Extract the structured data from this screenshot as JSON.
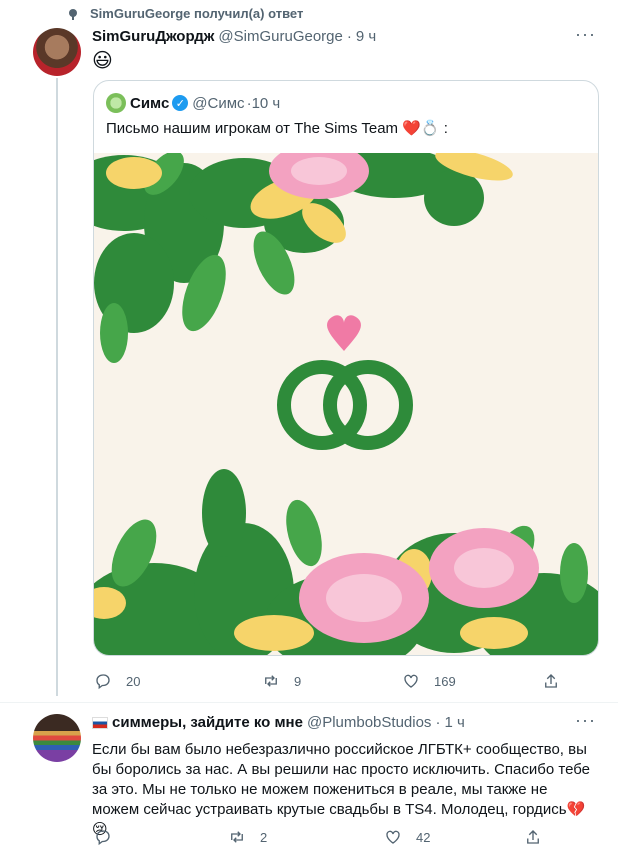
{
  "context": {
    "text": "SimGuruGeorge получил(а) ответ"
  },
  "tweet1": {
    "name": "SimGuruДжордж",
    "handle": "@SimGuruGeorge",
    "dot": "·",
    "time": "9 ч",
    "more": "···",
    "text": "😃",
    "quote": {
      "name": "Симс",
      "handle": "@Симс",
      "dot": "·",
      "time": "10 ч",
      "text": "Письмо нашим игрокам от The Sims Team ❤️💍 :",
      "image": "wedding-rings-flowers-illustration"
    },
    "stats": {
      "replies": "20",
      "retweets": "9",
      "likes": "169"
    }
  },
  "tweet2": {
    "name": "симмеры, зайдите ко мне",
    "handle": "@PlumbobStudios",
    "dot": "·",
    "time": "1 ч",
    "more": "···",
    "text": "Если бы вам было небезразлично российское ЛГБТК+ сообщество, вы бы боролись за нас. А вы решили нас просто исключить. Спасибо тебе за это. Мы не только не можем пожениться в реале, мы также не можем сейчас устраивать крутые свадьбы в TS4. Молодец, гордись💔😢",
    "stats": {
      "replies": "",
      "retweets": "2",
      "likes": "42"
    }
  },
  "colors": {
    "muted": "#536471",
    "ring": "#2e8b3a",
    "heart": "#f07aa5",
    "bg": "#f9f3ea"
  }
}
